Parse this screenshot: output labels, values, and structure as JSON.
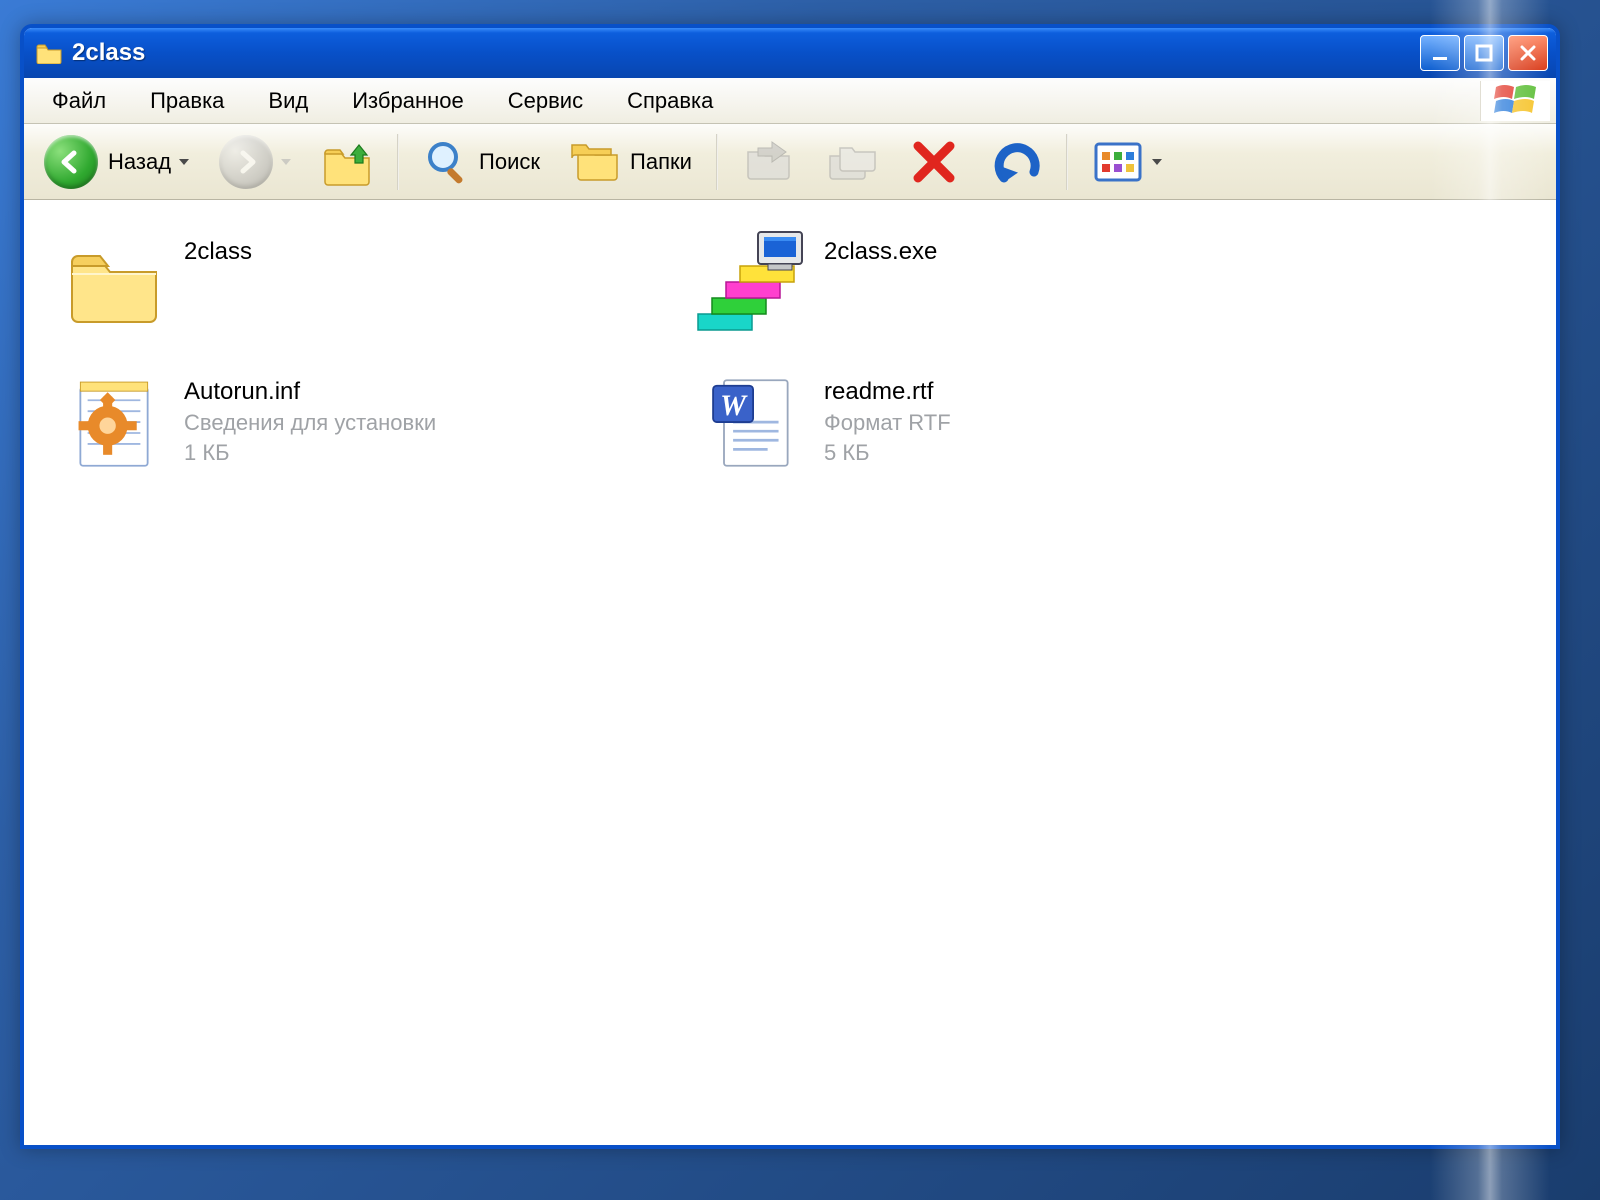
{
  "window": {
    "title": "2class"
  },
  "menu": {
    "items": [
      "Файл",
      "Правка",
      "Вид",
      "Избранное",
      "Сервис",
      "Справка"
    ]
  },
  "toolbar": {
    "back_label": "Назад",
    "search_label": "Поиск",
    "folders_label": "Папки"
  },
  "files": [
    {
      "name": "2class",
      "type": "",
      "size": "",
      "icon": "folder"
    },
    {
      "name": "2class.exe",
      "type": "",
      "size": "",
      "icon": "exe-steps"
    },
    {
      "name": "Autorun.inf",
      "type": "Сведения для установки",
      "size": "1 КБ",
      "icon": "inf-gear"
    },
    {
      "name": "readme.rtf",
      "type": "Формат RTF",
      "size": "5 КБ",
      "icon": "word-doc"
    }
  ]
}
